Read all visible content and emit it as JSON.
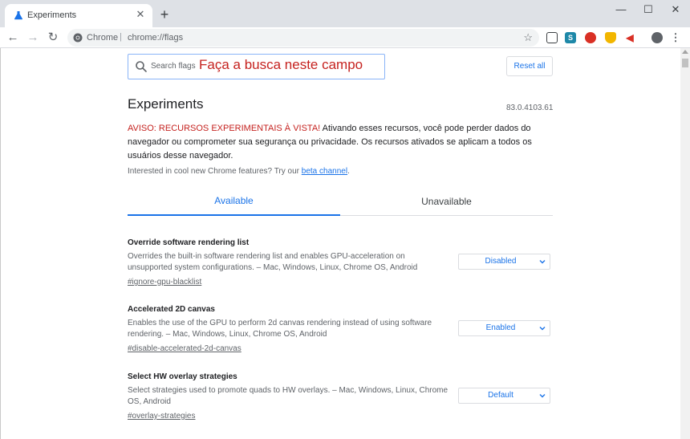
{
  "browser": {
    "tab_title": "Experiments",
    "tab_icon": "flask-icon",
    "omnibox_site": "Chrome",
    "omnibox_separator": "|",
    "omnibox_url": "chrome://flags"
  },
  "page": {
    "search_placeholder": "Search flags",
    "search_annotation": "Faça a busca neste campo",
    "reset_all_label": "Reset all",
    "heading": "Experiments",
    "version": "83.0.4103.61",
    "warning_lead": "AVISO: RECURSOS EXPERIMENTAIS À VISTA!",
    "warning_body": " Ativando esses recursos, você pode perder dados do navegador ou comprometer sua segurança ou privacidade. Os recursos ativados se aplicam a todos os usuários desse navegador.",
    "cool_text": "Interested in cool new Chrome features? Try our ",
    "cool_link": "beta channel",
    "cool_period": ".",
    "tabs": [
      {
        "label": "Available",
        "active": true
      },
      {
        "label": "Unavailable",
        "active": false
      }
    ],
    "flags": [
      {
        "title": "Override software rendering list",
        "description": "Overrides the built-in software rendering list and enables GPU-acceleration on unsupported system configurations. – Mac, Windows, Linux, Chrome OS, Android",
        "link": "#ignore-gpu-blacklist",
        "value": "Disabled"
      },
      {
        "title": "Accelerated 2D canvas",
        "description": "Enables the use of the GPU to perform 2d canvas rendering instead of using software rendering. – Mac, Windows, Linux, Chrome OS, Android",
        "link": "#disable-accelerated-2d-canvas",
        "value": "Enabled"
      },
      {
        "title": "Select HW overlay strategies",
        "description": "Select strategies used to promote quads to HW overlays. – Mac, Windows, Linux, Chrome OS, Android",
        "link": "#overlay-strategies",
        "value": "Default"
      }
    ]
  },
  "colors": {
    "accent": "#1a73e8",
    "warning": "#c5221f",
    "tabstrip": "#dee1e6"
  }
}
